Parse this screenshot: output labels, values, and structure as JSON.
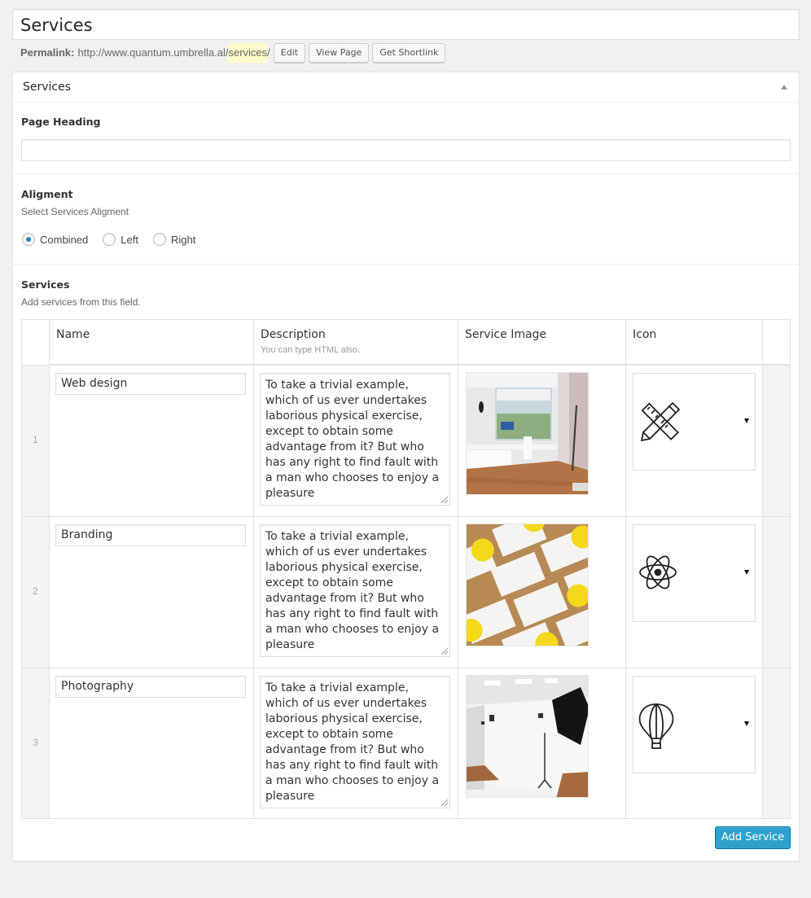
{
  "page_title": "Services",
  "permalink": {
    "label": "Permalink:",
    "base_url": "http://www.quantum.umbrella.al/",
    "slug": "services",
    "trailing": "/",
    "buttons": {
      "edit": "Edit",
      "view_page": "View Page",
      "get_shortlink": "Get Shortlink"
    }
  },
  "metabox": {
    "title": "Services",
    "page_heading": {
      "label": "Page Heading",
      "value": ""
    },
    "alignment": {
      "label": "Aligment",
      "description": "Select Services Aligment",
      "options": [
        "Combined",
        "Left",
        "Right"
      ],
      "selected": "Combined"
    },
    "services": {
      "label": "Services",
      "description": "Add services from this field.",
      "columns": {
        "name": "Name",
        "description": "Description",
        "description_hint": "You can type HTML also.",
        "image": "Service Image",
        "icon": "Icon"
      },
      "rows": [
        {
          "index": "1",
          "name": "Web design",
          "description": "To take a trivial example, which of us ever undertakes laborious physical exercise, except to obtain some advantage from it? But who has any right to find fault with a man who chooses to enjoy a pleasure",
          "image": "office-interior-photo",
          "icon": "pencil-ruler-icon"
        },
        {
          "index": "2",
          "name": "Branding",
          "description": "To take a trivial example, which of us ever undertakes laborious physical exercise, except to obtain some advantage from it? But who has any right to find fault with a man who chooses to enjoy a pleasure",
          "image": "business-cards-photo",
          "icon": "atom-icon"
        },
        {
          "index": "3",
          "name": "Photography",
          "description": "To take a trivial example, which of us ever undertakes laborious physical exercise, except to obtain some advantage from it? But who has any right to find fault with a man who chooses to enjoy a pleasure",
          "image": "photo-studio-photo",
          "icon": "hot-air-balloon-icon"
        }
      ],
      "add_button": "Add Service"
    }
  },
  "colors": {
    "accent": "#2ea2cc",
    "radio_dot": "#1e8cbe",
    "slug_highlight": "#fffbcc"
  }
}
